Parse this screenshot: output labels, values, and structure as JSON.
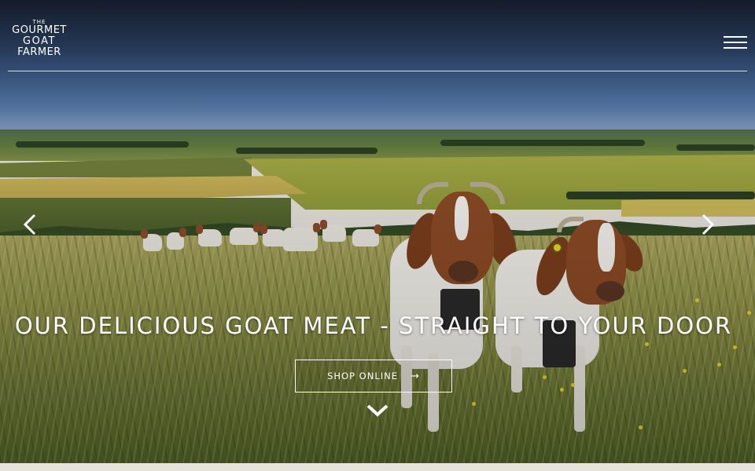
{
  "header": {
    "logo": {
      "the": "THE",
      "line1": "GOURMET",
      "line2": "GOAT",
      "line3": "FARMER"
    },
    "menu_icon": "hamburger-menu-icon"
  },
  "hero": {
    "headline": "OUR DELICIOUS GOAT MEAT - STRAIGHT TO YOUR DOOR",
    "cta_label": "SHOP ONLINE",
    "cta_arrow": "→",
    "prev_icon": "chevron-left-icon",
    "next_icon": "chevron-right-icon",
    "scroll_icon": "chevron-down-icon"
  },
  "colors": {
    "text": "#ffffff",
    "header_rule": "#cfe0ef",
    "footer_band": "#e6e2dc"
  }
}
